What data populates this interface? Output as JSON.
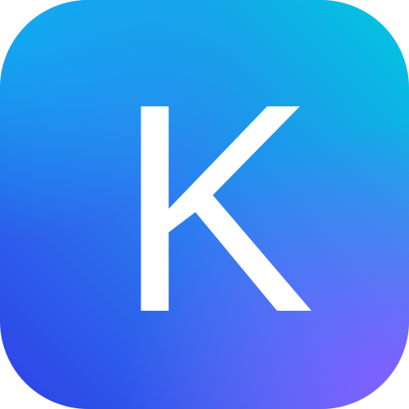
{
  "app_icon": {
    "letter": "K",
    "colors": {
      "top_right": "#00C8E0",
      "top_left": "#0AB4F0",
      "bottom_left": "#2E3FE6",
      "bottom_right": "#8A5CFF",
      "glyph": "#FFFFFF"
    }
  }
}
